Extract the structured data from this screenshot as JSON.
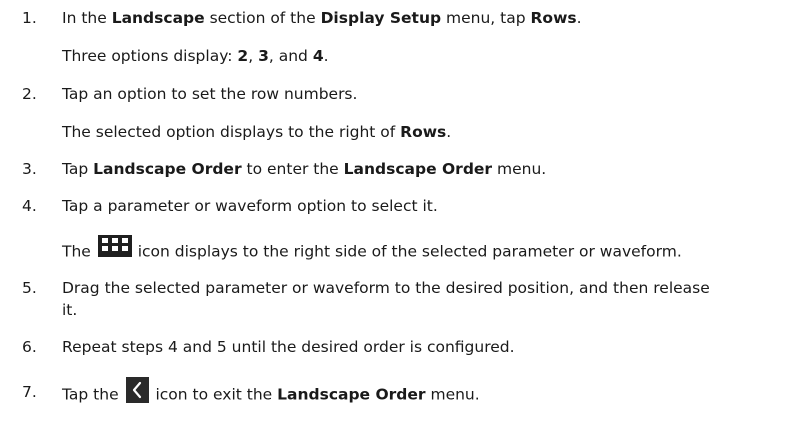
{
  "steps": [
    {
      "number": "1.",
      "line1": {
        "t1": "In the ",
        "b1": "Landscape",
        "t2": " section of the ",
        "b2": "Display Setup",
        "t3": " menu, tap ",
        "b3": "Rows",
        "t4": "."
      },
      "result": {
        "t1": "Three options display: ",
        "b1": "2",
        "t2": ", ",
        "b2": "3",
        "t3": ", and ",
        "b3": "4",
        "t4": "."
      }
    },
    {
      "number": "2.",
      "line1": "Tap an option to set the row numbers.",
      "result": {
        "t1": "The selected option displays to the right of ",
        "b1": "Rows",
        "t2": "."
      }
    },
    {
      "number": "3.",
      "line1": {
        "t1": "Tap ",
        "b1": "Landscape Order",
        "t2": " to enter the ",
        "b2": "Landscape Order",
        "t3": " menu."
      }
    },
    {
      "number": "4.",
      "line1": "Tap a parameter or waveform option to select it.",
      "result": {
        "t1": "The ",
        "icon": "grid-drag-handle-icon",
        "t2": " icon displays to the right side of the selected parameter or waveform."
      }
    },
    {
      "number": "5.",
      "line1": "Drag the selected parameter or waveform to the desired position, and then release",
      "line2": "it."
    },
    {
      "number": "6.",
      "line1": "Repeat steps 4 and 5 until the desired order is configured."
    },
    {
      "number": "7.",
      "line1": {
        "t1": "Tap the ",
        "icon": "back-arrow-icon",
        "t2": " icon to exit the ",
        "b1": "Landscape Order",
        "t3": " menu."
      }
    }
  ],
  "colors": {
    "text": "#1a1a1a",
    "icon_background": "#1f1f1f",
    "icon_foreground": "#ffffff"
  }
}
